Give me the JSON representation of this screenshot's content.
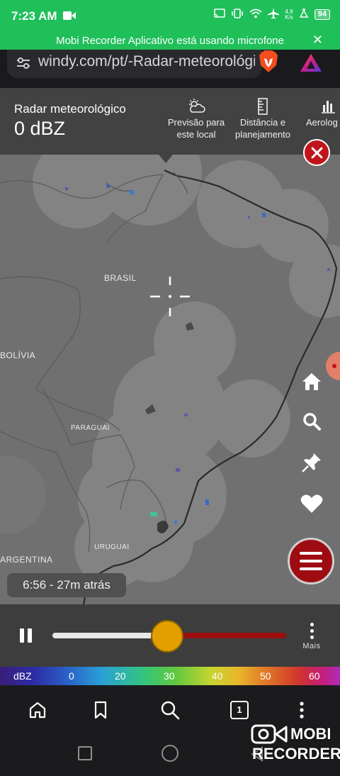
{
  "status_bar": {
    "time": "7:23 AM",
    "net_speed_value": "4,9",
    "net_speed_unit": "K/s",
    "battery": "94"
  },
  "notification": {
    "text": "Mobi Recorder Aplicativo está usando microfone",
    "close_symbol": "✕"
  },
  "browser": {
    "url": "windy.com/pt/-Radar-meteorológico"
  },
  "header": {
    "title": "Radar meteorológico",
    "value": "0 dBZ",
    "buttons": [
      {
        "icon": "weather-cloud-sun-icon",
        "label_line1": "Previsão para",
        "label_line2": "este local"
      },
      {
        "icon": "ruler-icon",
        "label_line1": "Distância e",
        "label_line2": "planejamento"
      },
      {
        "icon": "bar-chart-icon",
        "label_line1": "Aerolog",
        "label_line2": ""
      }
    ]
  },
  "map": {
    "labels": {
      "brasil": "BRASIL",
      "bolivia": "BOLÍVIA",
      "paraguai": "PARAGUAI",
      "uruguai": "URUGUAI",
      "argentina": "ARGENTINA"
    },
    "side_buttons": [
      "home-icon",
      "search-icon",
      "pin-icon",
      "heart-icon"
    ]
  },
  "timeline": {
    "time_label": "6:56 - 27m atrás",
    "progress_fraction": 0.49,
    "more_label": "Mais"
  },
  "legend": {
    "unit": "dBZ",
    "ticks": [
      "0",
      "20",
      "30",
      "40",
      "50",
      "60"
    ]
  },
  "bottom_nav": {
    "tab_count": "1"
  },
  "watermark": {
    "line1": "MOBI",
    "line2": "RECORDER"
  },
  "colors": {
    "status_green": "#1fbf5a",
    "accent_red": "#c0141c",
    "slider_knob": "#e2a000",
    "map_gray": "#707070"
  }
}
